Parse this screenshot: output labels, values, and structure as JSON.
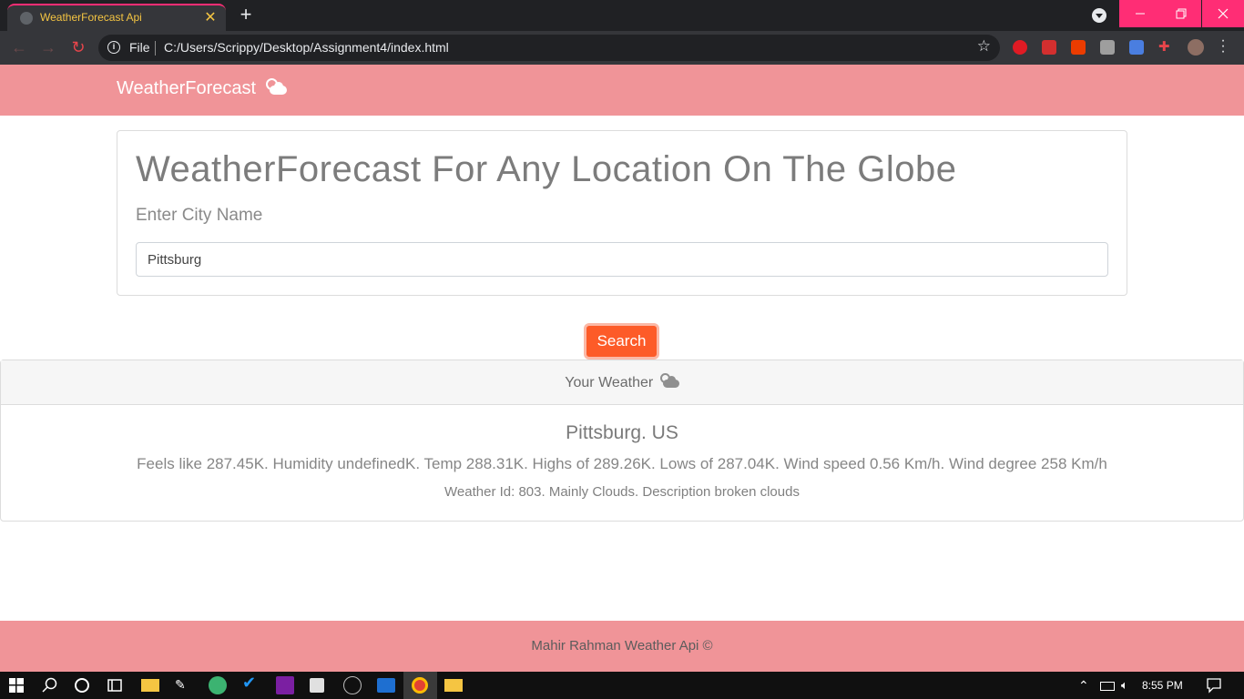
{
  "browser": {
    "tab_title": "WeatherForecast Api",
    "tab_close": "✕",
    "new_tab": "+",
    "scheme_label": "File",
    "url": "C:/Users/Scrippy/Desktop/Assignment4/index.html"
  },
  "navbar": {
    "brand": "WeatherForecast"
  },
  "jumbotron": {
    "heading": "WeatherForecast For Any Location On The Globe",
    "lead": "Enter City Name",
    "city_value": "Pittsburg"
  },
  "search_button": "Search",
  "weather_card": {
    "header": "Your Weather",
    "city": "Pittsburg. US",
    "details": "Feels like 287.45K. Humidity undefinedK. Temp 288.31K. Highs of 289.26K. Lows of 287.04K. Wind speed 0.56 Km/h. Wind degree 258 Km/h",
    "weather_id": "Weather Id: 803. Mainly Clouds. Description broken clouds"
  },
  "footer": "Mahir Rahman Weather Api ©",
  "taskbar": {
    "time": "8:55 PM"
  },
  "colors": {
    "navbar": "#f09498",
    "button": "#fd5b28",
    "tab_accent": "#ff2d75"
  }
}
